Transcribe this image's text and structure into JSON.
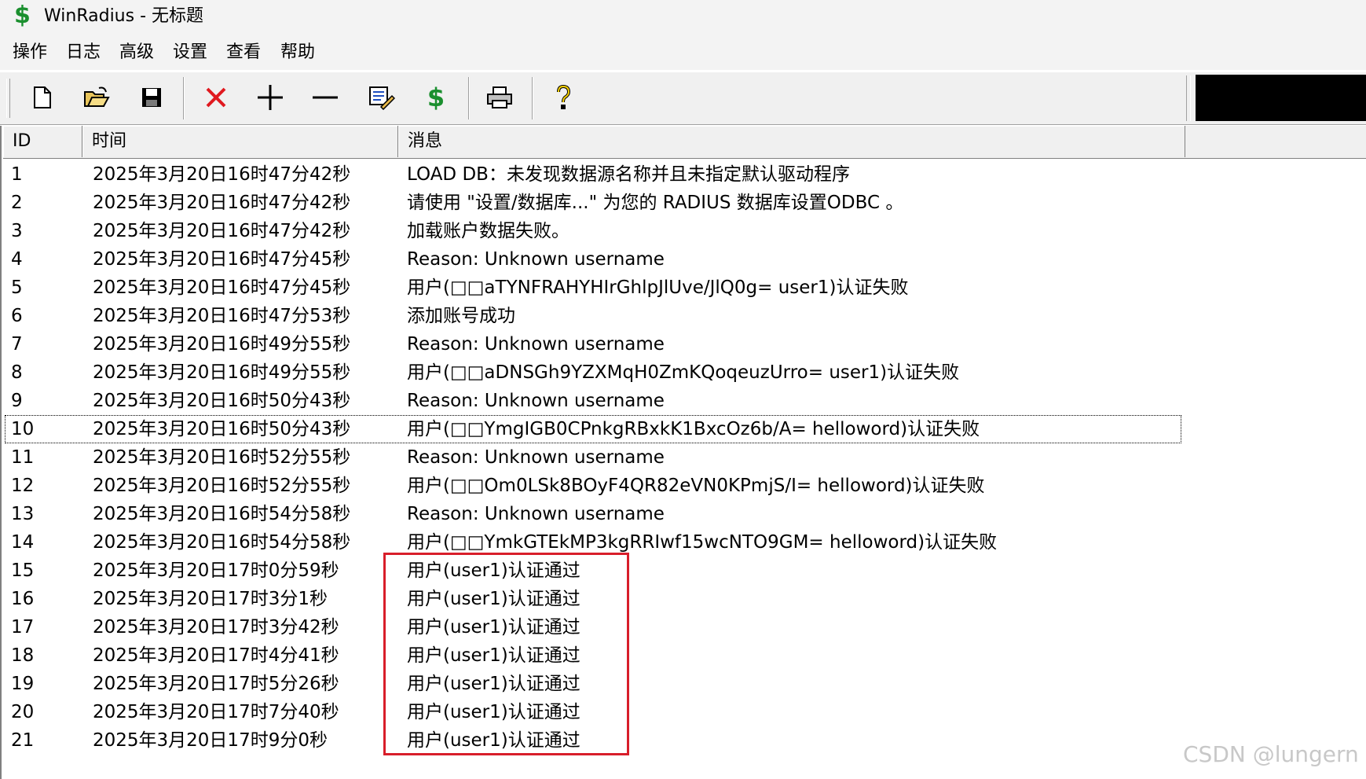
{
  "window": {
    "title": "WinRadius - 无标题"
  },
  "menu": [
    "操作",
    "日志",
    "高级",
    "设置",
    "查看",
    "帮助"
  ],
  "toolbar": {
    "icons": [
      "new-file-icon",
      "open-folder-icon",
      "save-icon",
      "delete-icon",
      "add-icon",
      "remove-icon",
      "edit-icon",
      "dollar-icon",
      "print-icon",
      "help-icon"
    ]
  },
  "table": {
    "columns": [
      "ID",
      "时间",
      "消息"
    ],
    "rows": [
      {
        "id": "1",
        "time": "2025年3月20日16时47分42秒",
        "msg": "LOAD DB：未发现数据源名称并且未指定默认驱动程序"
      },
      {
        "id": "2",
        "time": "2025年3月20日16时47分42秒",
        "msg": "请使用 \"设置/数据库...\" 为您的 RADIUS 数据库设置ODBC 。"
      },
      {
        "id": "3",
        "time": "2025年3月20日16时47分42秒",
        "msg": "加载账户数据失败。"
      },
      {
        "id": "4",
        "time": "2025年3月20日16时47分45秒",
        "msg": "Reason: Unknown username"
      },
      {
        "id": "5",
        "time": "2025年3月20日16时47分45秒",
        "msg": "用户(□□aTYNFRAHYHIrGhlpJlUve/JlQ0g=  user1)认证失败"
      },
      {
        "id": "6",
        "time": "2025年3月20日16时47分53秒",
        "msg": "添加账号成功"
      },
      {
        "id": "7",
        "time": "2025年3月20日16时49分55秒",
        "msg": "Reason: Unknown username"
      },
      {
        "id": "8",
        "time": "2025年3月20日16时49分55秒",
        "msg": "用户(□□aDNSGh9YZXMqH0ZmKQoqeuzUrro=  user1)认证失败"
      },
      {
        "id": "9",
        "time": "2025年3月20日16时50分43秒",
        "msg": "Reason: Unknown username"
      },
      {
        "id": "10",
        "time": "2025年3月20日16时50分43秒",
        "msg": "用户(□□YmgIGB0CPnkgRBxkK1BxcOz6b/A=  helloword)认证失败"
      },
      {
        "id": "11",
        "time": "2025年3月20日16时52分55秒",
        "msg": "Reason: Unknown username"
      },
      {
        "id": "12",
        "time": "2025年3月20日16时52分55秒",
        "msg": "用户(□□Om0LSk8BOyF4QR82eVN0KPmjS/I=  helloword)认证失败"
      },
      {
        "id": "13",
        "time": "2025年3月20日16时54分58秒",
        "msg": "Reason: Unknown username"
      },
      {
        "id": "14",
        "time": "2025年3月20日16时54分58秒",
        "msg": "用户(□□YmkGTEkMP3kgRRIwf15wcNTO9GM=  helloword)认证失败"
      },
      {
        "id": "15",
        "time": "2025年3月20日17时0分59秒",
        "msg": "用户(user1)认证通过"
      },
      {
        "id": "16",
        "time": "2025年3月20日17时3分1秒",
        "msg": "用户(user1)认证通过"
      },
      {
        "id": "17",
        "time": "2025年3月20日17时3分42秒",
        "msg": "用户(user1)认证通过"
      },
      {
        "id": "18",
        "time": "2025年3月20日17时4分41秒",
        "msg": "用户(user1)认证通过"
      },
      {
        "id": "19",
        "time": "2025年3月20日17时5分26秒",
        "msg": "用户(user1)认证通过"
      },
      {
        "id": "20",
        "time": "2025年3月20日17时7分40秒",
        "msg": "用户(user1)认证通过"
      },
      {
        "id": "21",
        "time": "2025年3月20日17时9分0秒",
        "msg": "用户(user1)认证通过"
      }
    ],
    "focused_row": 10
  },
  "watermark": "CSDN @lungern",
  "colors": {
    "highlight_box": "#d81e2a",
    "dollar": "#1a8f2e"
  }
}
